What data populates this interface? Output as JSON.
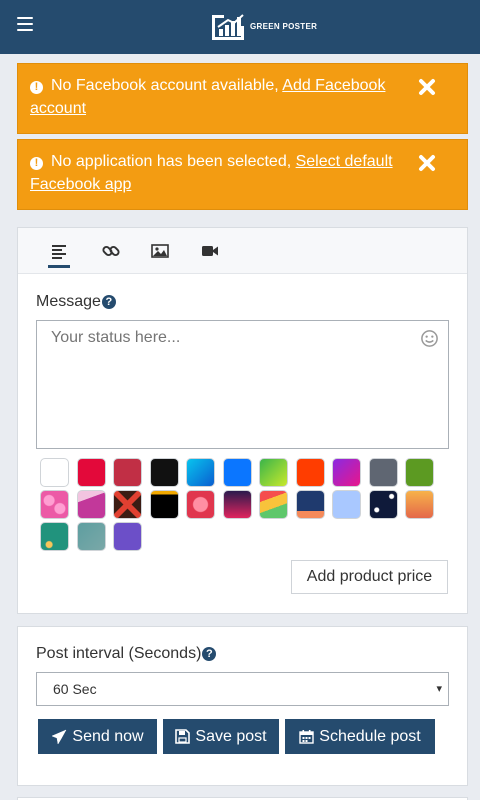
{
  "header": {
    "logo_text": "GREEN POSTER"
  },
  "alerts": [
    {
      "text": "No Facebook account available, ",
      "link": "Add Facebook account"
    },
    {
      "text": "No application has been selected, ",
      "link": "Select default Facebook app"
    }
  ],
  "composer": {
    "tabs": [
      "text-icon",
      "link-icon",
      "image-icon",
      "video-icon"
    ],
    "message_label": "Message",
    "help_glyph": "?",
    "message_placeholder": "Your status here...",
    "message_value": "",
    "add_price_label": "Add product price",
    "swatches": [
      "plain-white",
      "crimson",
      "brick-red",
      "black",
      "cyan-blue-gradient",
      "blue",
      "green-yellow-gradient",
      "orange-red",
      "purple-magenta-gradient",
      "slate-gray",
      "olive-green",
      "pink-hearts",
      "magenta-envelope",
      "dark-red-x",
      "black-sparkle",
      "red-hearts",
      "dusk-gradient",
      "rainbow-stripes",
      "navy-pattern",
      "light-blue",
      "night-stars",
      "orange-sunset",
      "teal-pattern",
      "gray-teal-texture",
      "violet"
    ]
  },
  "post_settings": {
    "interval_label": "Post interval (Seconds)",
    "interval_value": "60 Sec",
    "send_now_label": "Send now",
    "save_post_label": "Save post",
    "schedule_post_label": "Schedule post"
  },
  "colors": {
    "header_bg": "#254b6e",
    "alert_bg": "#f39c12",
    "primary_button": "#254b6e",
    "page_bg": "#e9ecf1"
  }
}
